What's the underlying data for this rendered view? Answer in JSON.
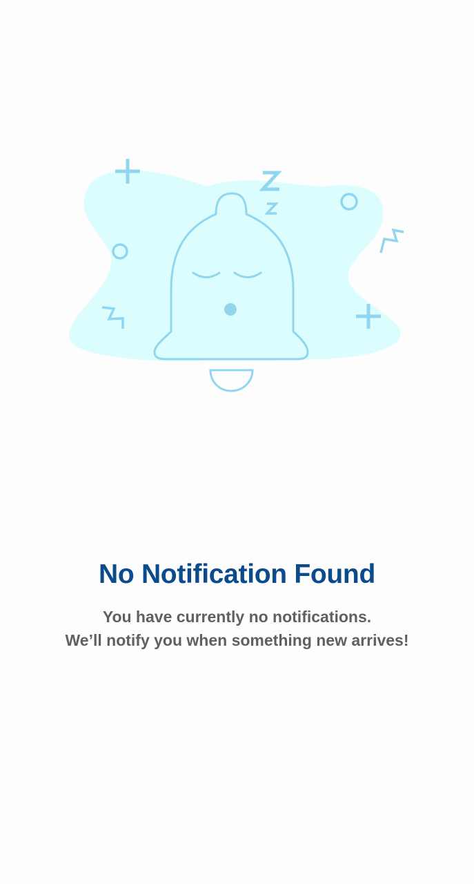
{
  "empty_state": {
    "illustration": "sleeping-bell-illustration",
    "title": "No Notification Found",
    "message_line1": "You have currently no notifications.",
    "message_line2": "We’ll notify you when something new arrives!"
  },
  "colors": {
    "background": "#fdfdfd",
    "blob": "#dcfdfd",
    "outline": "#8fd6ee",
    "title": "#0b4a8b",
    "message": "#606060"
  }
}
